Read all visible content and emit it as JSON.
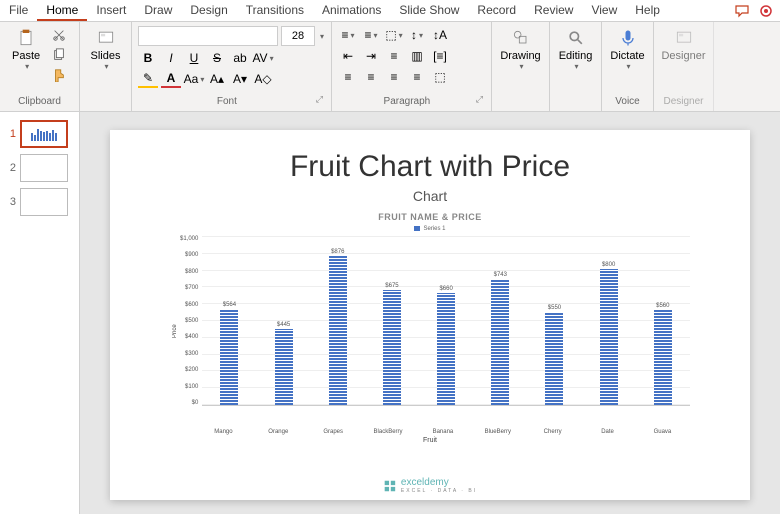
{
  "menu": {
    "file": "File",
    "home": "Home",
    "insert": "Insert",
    "draw": "Draw",
    "design": "Design",
    "transitions": "Transitions",
    "animations": "Animations",
    "slideshow": "Slide Show",
    "record": "Record",
    "review": "Review",
    "view": "View",
    "help": "Help"
  },
  "ribbon": {
    "clipboard": {
      "paste": "Paste",
      "label": "Clipboard"
    },
    "slides": {
      "slides": "Slides",
      "label": ""
    },
    "font": {
      "size": "28",
      "label": "Font"
    },
    "paragraph": {
      "label": "Paragraph"
    },
    "drawing": {
      "drawing": "Drawing",
      "label": ""
    },
    "editing": {
      "editing": "Editing",
      "label": ""
    },
    "voice": {
      "dictate": "Dictate",
      "label": "Voice"
    },
    "designer": {
      "designer": "Designer",
      "label": "Designer"
    }
  },
  "slides_panel": {
    "n1": "1",
    "n2": "2",
    "n3": "3"
  },
  "slide": {
    "title": "Fruit Chart with Price",
    "subtitle": "Chart",
    "chart_title": "FRUIT NAME & PRICE",
    "legend": "Series 1",
    "ylabel": "Price",
    "xlabel": "Fruit",
    "watermark": "exceldemy",
    "watermark_sub": "EXCEL · DATA · BI"
  },
  "chart_data": {
    "type": "bar",
    "title": "FRUIT NAME & PRICE",
    "xlabel": "Fruit",
    "ylabel": "Price",
    "ylim": [
      0,
      1000
    ],
    "yticks": [
      "$1,000",
      "$900",
      "$800",
      "$700",
      "$600",
      "$500",
      "$400",
      "$300",
      "$200",
      "$100",
      "$0"
    ],
    "series": [
      {
        "name": "Series 1",
        "values": [
          564,
          445,
          876,
          675,
          660,
          743,
          550,
          800,
          560
        ]
      }
    ],
    "categories": [
      "Mango",
      "Orange",
      "Grapes",
      "BlackBerry",
      "Banana",
      "BlueBerry",
      "Cherry",
      "Date",
      "Guava"
    ],
    "value_labels": [
      "$564",
      "$445",
      "$876",
      "$675",
      "$660",
      "$743",
      "$550",
      "$800",
      "$560"
    ]
  }
}
